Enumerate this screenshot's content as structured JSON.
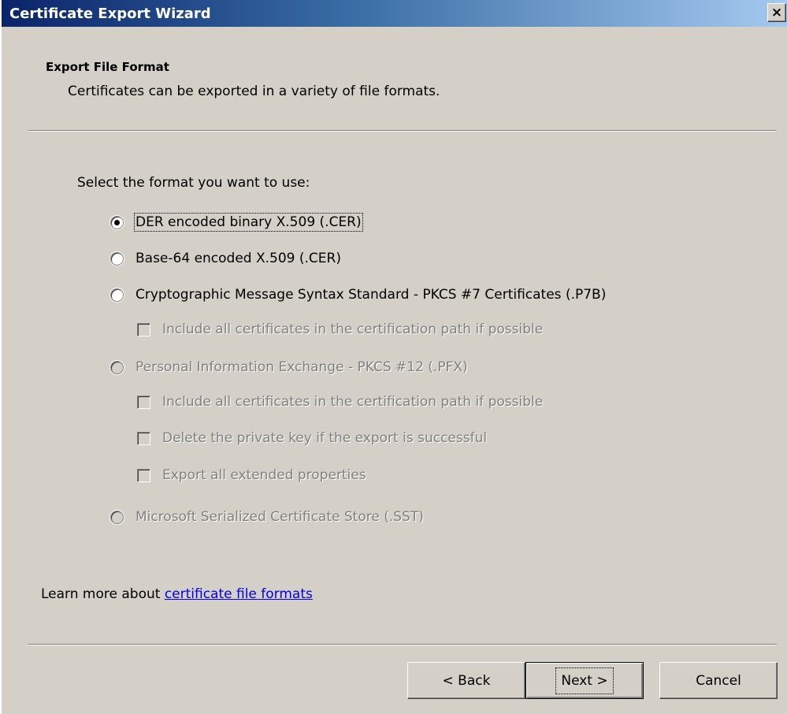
{
  "window": {
    "title": "Certificate Export Wizard",
    "close_glyph": "×"
  },
  "header": {
    "title": "Export File Format",
    "subtitle": "Certificates can be exported in a variety of file formats."
  },
  "main": {
    "prompt": "Select the format you want to use:",
    "options": [
      {
        "label": "DER encoded binary X.509 (.CER)",
        "type": "radio",
        "checked": true,
        "enabled": true
      },
      {
        "label": "Base-64 encoded X.509 (.CER)",
        "type": "radio",
        "checked": false,
        "enabled": true
      },
      {
        "label": "Cryptographic Message Syntax Standard - PKCS #7 Certificates (.P7B)",
        "type": "radio",
        "checked": false,
        "enabled": true
      },
      {
        "label": "Include all certificates in the certification path if possible",
        "type": "checkbox",
        "checked": false,
        "enabled": false
      },
      {
        "label": "Personal Information Exchange - PKCS #12 (.PFX)",
        "type": "radio",
        "checked": false,
        "enabled": false
      },
      {
        "label": "Include all certificates in the certification path if possible",
        "type": "checkbox",
        "checked": false,
        "enabled": false
      },
      {
        "label": "Delete the private key if the export is successful",
        "type": "checkbox",
        "checked": false,
        "enabled": false
      },
      {
        "label": "Export all extended properties",
        "type": "checkbox",
        "checked": false,
        "enabled": false
      },
      {
        "label": "Microsoft Serialized Certificate Store (.SST)",
        "type": "radio",
        "checked": false,
        "enabled": false
      }
    ]
  },
  "learn_more": {
    "prefix": "Learn more about ",
    "link": "certificate file formats"
  },
  "buttons": {
    "back": "< Back",
    "next": "Next >",
    "cancel": "Cancel"
  }
}
